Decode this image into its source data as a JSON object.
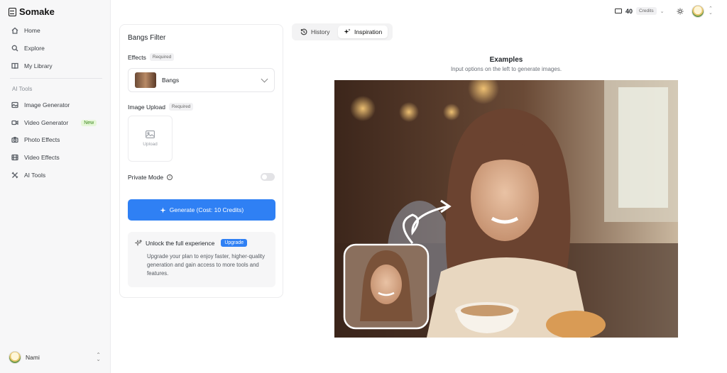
{
  "app": {
    "name": "Somake"
  },
  "sidebar": {
    "items": [
      {
        "label": "Home",
        "icon": "home-icon"
      },
      {
        "label": "Explore",
        "icon": "search-icon"
      },
      {
        "label": "My Library",
        "icon": "book-icon"
      }
    ],
    "section_label": "AI Tools",
    "tools": [
      {
        "label": "Image Generator",
        "icon": "image-icon"
      },
      {
        "label": "Video Generator",
        "icon": "video-icon",
        "badge": "New"
      },
      {
        "label": "Photo Effects",
        "icon": "camera-icon"
      },
      {
        "label": "Video Effects",
        "icon": "film-icon"
      },
      {
        "label": "AI Tools",
        "icon": "tools-icon"
      }
    ],
    "user": {
      "name": "Nami"
    }
  },
  "topbar": {
    "credits": "40",
    "credits_label": "Credits"
  },
  "form": {
    "title": "Bangs Filter",
    "effects_label": "Effects",
    "required": "Required",
    "effect_value": "Bangs",
    "upload_label": "Image Upload",
    "upload_text": "Upload",
    "private_label": "Private Mode",
    "generate_label": "Generate (Cost: 10 Credits)",
    "promo": {
      "title": "Unlock the full experience",
      "button": "Upgrade",
      "text": "Upgrade your plan to enjoy faster, higher-quality generation and gain access to more tools and features."
    }
  },
  "tabs": [
    {
      "label": "History"
    },
    {
      "label": "Inspiration"
    }
  ],
  "examples": {
    "title": "Examples",
    "subtitle": "Input options on the left to generate images."
  },
  "colors": {
    "accent": "#2f80f4",
    "badge_new": "#e6f7d9"
  }
}
